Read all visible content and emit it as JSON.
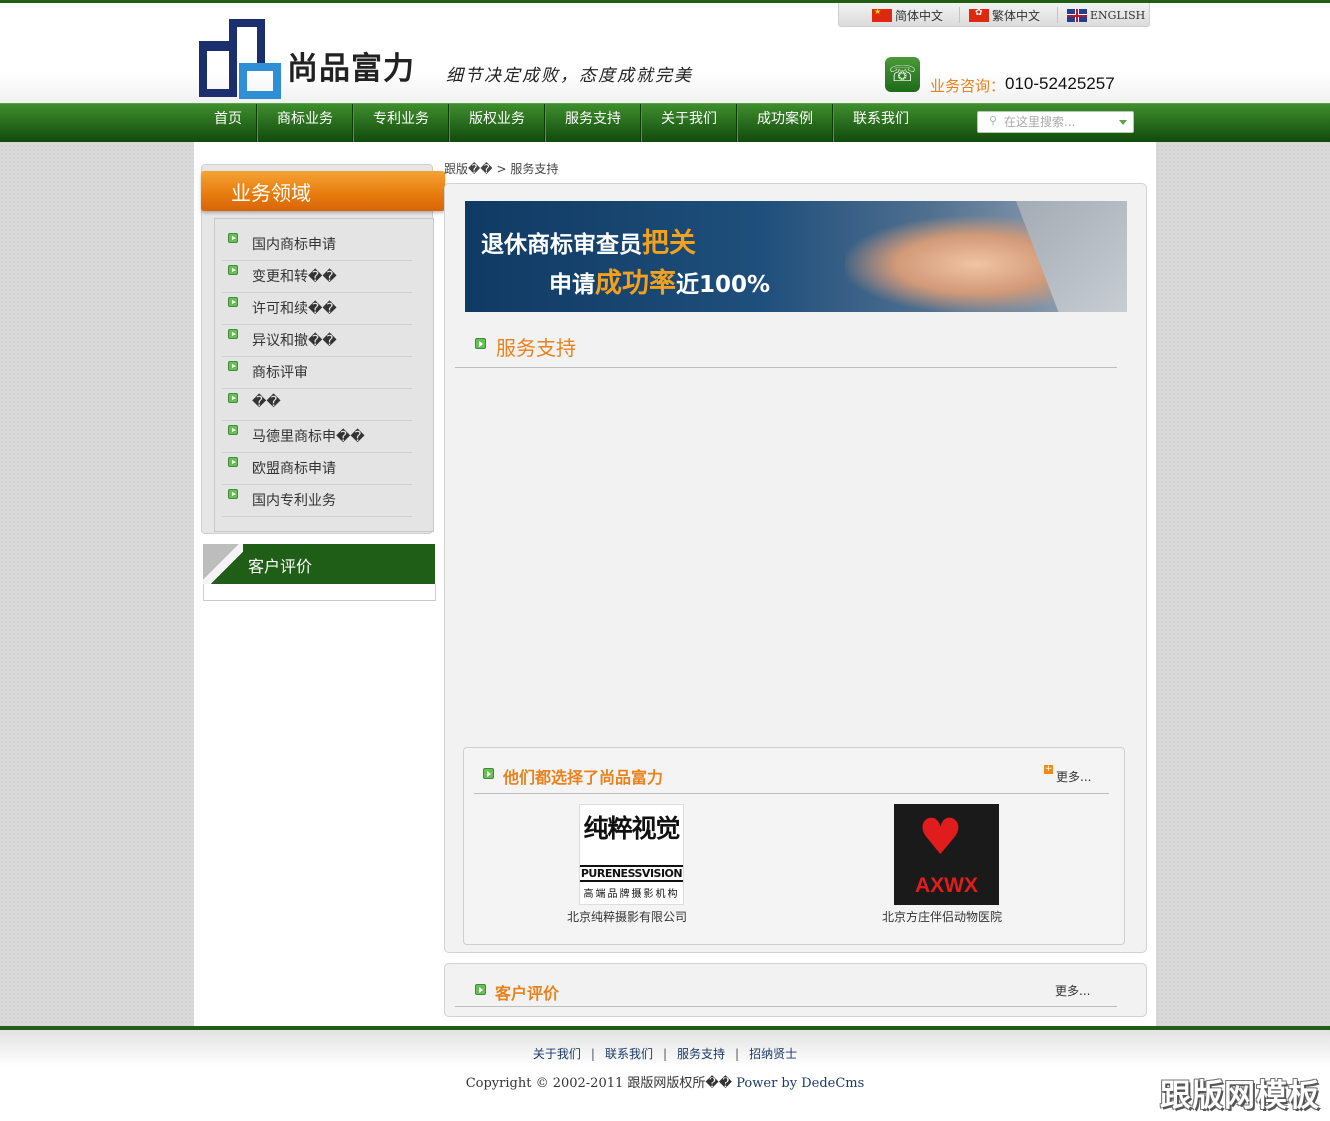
{
  "header": {
    "languages": [
      "简体中文",
      "繁体中文",
      "ENGLISH"
    ],
    "logo_text": "尚品富力",
    "slogan": "细节决定成败，态度成就完美",
    "hotline_label": "业务咨询：",
    "hotline_number": "010-52425257"
  },
  "nav": {
    "items": [
      "首页",
      "商标业务",
      "专利业务",
      "版权业务",
      "服务支持",
      "关于我们",
      "成功案例",
      "联系我们"
    ],
    "search_placeholder": "在这里搜索..."
  },
  "sidebar": {
    "title": "业务领域",
    "items": [
      "国内商标申请",
      "变更和转��",
      "许可和续��",
      "异议和撤��",
      "商标评审",
      "��",
      "马德里商标申��",
      "欧盟商标申请",
      "国内专利业务"
    ],
    "comments_title": "客户评价"
  },
  "breadcrumb": {
    "home": "跟版��",
    "sep": ">",
    "current": "服务支持"
  },
  "banner": {
    "line1_prefix": "退休商标审查员",
    "line1_highlight": "把关",
    "line2_prefix": "申请",
    "line2_highlight": "成功率",
    "line2_suffix": "近100%"
  },
  "main": {
    "section_title": "服务支持"
  },
  "clients": {
    "title": "他们都选择了尚品富力",
    "more": "更多...",
    "items": [
      {
        "name": "北京纯粹摄影有限公司",
        "logo_big": "纯粹视觉",
        "logo_mid": "PURENESSVISION",
        "logo_small": "高端品牌摄影机构"
      },
      {
        "name": "北京方庄伴侣动物医院",
        "logo_text": "AXWX"
      }
    ]
  },
  "reviews": {
    "title": "客户评价",
    "more": "更多..."
  },
  "footer": {
    "links": [
      "关于我们",
      "联系我们",
      "服务支持",
      "招纳贤士"
    ],
    "copyright": "Copyright © 2002-2011 跟版网版权所��",
    "power": "Power by DedeCms",
    "watermark": "跟版网模板"
  }
}
